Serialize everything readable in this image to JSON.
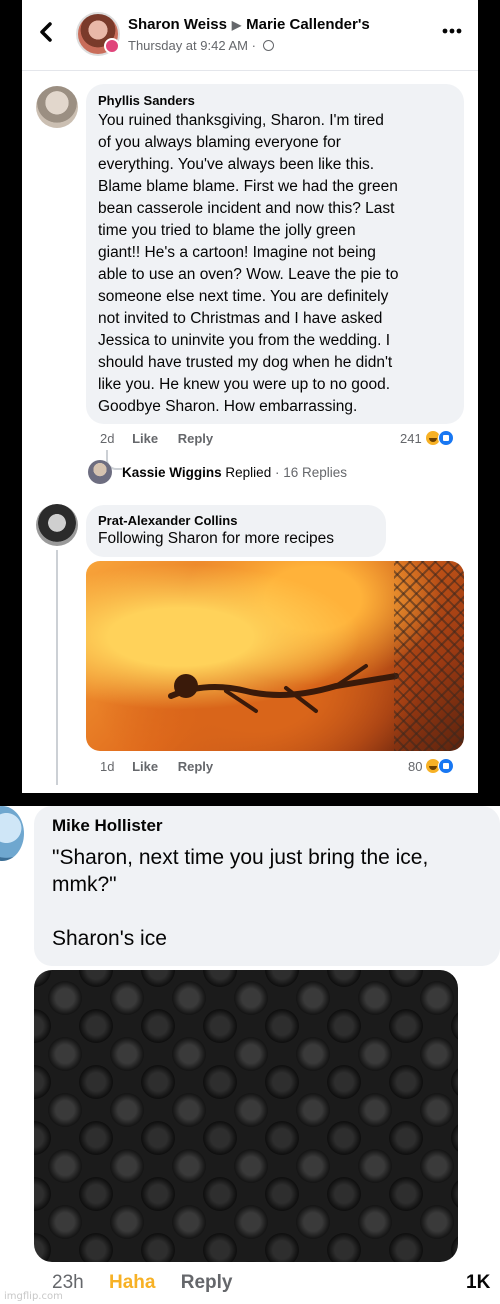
{
  "post": {
    "author": "Sharon Weiss",
    "target_page": "Marie Callender's",
    "timestamp": "Thursday at 9:42 AM",
    "separator": "·"
  },
  "icons": {
    "back": "chevron-left-icon",
    "more": "more-horizontal-icon",
    "audience": "globe-icon",
    "arrow": "right-triangle-icon"
  },
  "colors": {
    "facebook_blue": "#1877f2",
    "haha_yellow": "#f7b125",
    "bubble_bg": "#f0f2f5",
    "secondary_text": "#65676b"
  },
  "comments": [
    {
      "name": "Phyllis Sanders",
      "text": "You ruined thanksgiving, Sharon.  I'm tired\nof you always blaming everyone for\neverything.  You've always been like this.\nBlame blame blame.  First we had the green\nbean casserole incident and now this?  Last\ntime you tried to blame the jolly green\ngiant!! He's a cartoon!   Imagine not being\nable to use an oven? Wow.  Leave the pie to\nsomeone else next time.  You are definitely\nnot invited to Christmas and I have asked\nJessica to uninvite you from the wedding.  I\nshould have trusted my dog when he didn't\nlike you.  He knew you were up to no good.\nGoodbye Sharon.  How embarrassing.",
      "time": "2d",
      "like_label": "Like",
      "reply_label": "Reply",
      "reaction_count": "241"
    },
    {
      "name": "Prat-Alexander Collins",
      "text": "Following Sharon for more recipes",
      "time": "1d",
      "like_label": "Like",
      "reply_label": "Reply",
      "reaction_count": "80"
    },
    {
      "name": "Mike Hollister",
      "text": "\"Sharon, next time you just bring the ice,\nmmk?\"\n\nSharon's ice",
      "time": "23h",
      "reaction_label": "Haha",
      "reply_label": "Reply",
      "reaction_count": "1K"
    }
  ],
  "reply_summary": {
    "name": "Kassie Wiggins",
    "replied_label": "Replied",
    "separator": "·",
    "count_label": "16 Replies"
  },
  "watermark": "imgflip.com"
}
